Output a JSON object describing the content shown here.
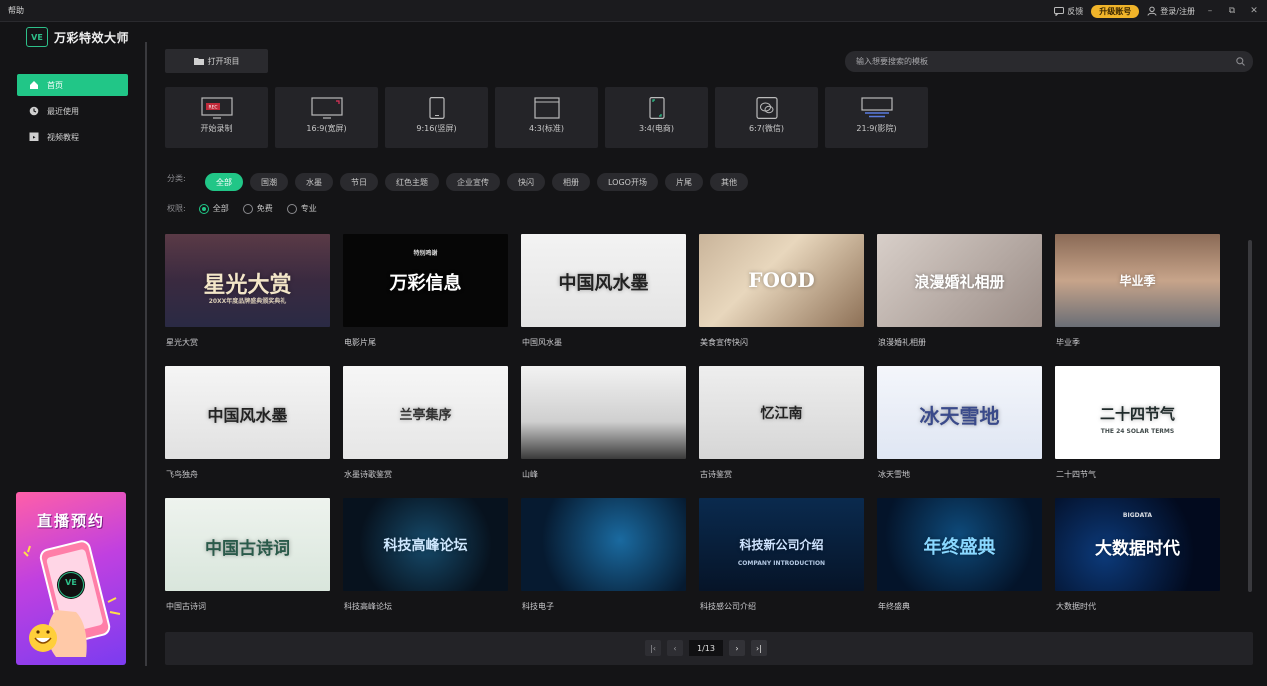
{
  "titlebar": {
    "menu_help": "帮助",
    "feedback": "反馈",
    "upgrade": "升级账号",
    "login": "登录/注册"
  },
  "sidebar": {
    "logo_mark": "VE",
    "app_name": "万彩特效大师",
    "items": [
      {
        "label": "首页",
        "icon": "home-icon"
      },
      {
        "label": "最近使用",
        "icon": "clock-icon"
      },
      {
        "label": "视频教程",
        "icon": "video-tutorial-icon"
      }
    ],
    "promo_title": "直播预约",
    "promo_mark": "VE"
  },
  "toolbar": {
    "open_project": "打开项目",
    "search_placeholder": "输入想要搜索的模板"
  },
  "presets": [
    {
      "label": "开始录制",
      "icon": "record-screen-icon"
    },
    {
      "label": "16:9(宽屏)",
      "icon": "widescreen-icon"
    },
    {
      "label": "9:16(竖屏)",
      "icon": "portrait-icon"
    },
    {
      "label": "4:3(标准)",
      "icon": "standard-icon"
    },
    {
      "label": "3:4(电商)",
      "icon": "ecommerce-icon"
    },
    {
      "label": "6:7(微信)",
      "icon": "wechat-icon"
    },
    {
      "label": "21:9(影院)",
      "icon": "cinema-icon"
    }
  ],
  "filters": {
    "category_label": "分类:",
    "categories": [
      "全部",
      "国潮",
      "水墨",
      "节日",
      "红色主题",
      "企业宣传",
      "快闪",
      "相册",
      "LOGO开场",
      "片尾",
      "其他"
    ],
    "permission_label": "权限:",
    "permissions": [
      "全部",
      "免费",
      "专业"
    ]
  },
  "templates": [
    {
      "name": "星光大赏",
      "text": "星光大赏",
      "bg": "linear-gradient(180deg,#5a3a46 0%,#3a2a40 50%,#2a2a44 100%)",
      "color": "#f3e6c8",
      "size": 22,
      "sub": "20XX年度品牌盛典颁奖典礼"
    },
    {
      "name": "电影片尾",
      "text": "万彩信息",
      "bg": "#060606",
      "color": "#ffffff",
      "size": 18,
      "sub": "特别鸣谢"
    },
    {
      "name": "中国风水墨",
      "text": "中国风水墨",
      "bg": "linear-gradient(180deg,#f3f3f3,#e4e4e4)",
      "color": "#222",
      "size": 18,
      "sub": ""
    },
    {
      "name": "美食宣传快闪",
      "text": "FOOD",
      "bg": "linear-gradient(135deg,#c9b49a 0%,#e8d7bd 40%,#8d7056 100%)",
      "color": "#ffffff",
      "size": 20,
      "sub": ""
    },
    {
      "name": "浪漫婚礼相册",
      "text": "浪漫婚礼相册",
      "bg": "linear-gradient(135deg,#d8cfc9,#9a8c86)",
      "color": "#ffffff",
      "size": 15,
      "sub": ""
    },
    {
      "name": "毕业季",
      "text": "毕业季",
      "bg": "linear-gradient(180deg,#8a6a56 0%,#c7a48a 50%,#6a6e76 100%)",
      "color": "#ffffff",
      "size": 12,
      "sub": ""
    },
    {
      "name": "飞鸟独舟",
      "text": "中国风水墨",
      "bg": "linear-gradient(180deg,#f5f5f5,#e1e1e1)",
      "color": "#222",
      "size": 16,
      "sub": ""
    },
    {
      "name": "水墨诗歌鉴赏",
      "text": "兰亭集序",
      "bg": "linear-gradient(180deg,#f6f6f6,#e6e6e6)",
      "color": "#333",
      "size": 13,
      "sub": ""
    },
    {
      "name": "山峰",
      "text": "",
      "bg": "linear-gradient(180deg,#f2f2f2 0%,#cfcfcf 60%,#3a3a3a 100%)",
      "color": "#222",
      "size": 14,
      "sub": ""
    },
    {
      "name": "古诗鉴赏",
      "text": "忆江南",
      "bg": "linear-gradient(180deg,#eeeeee,#d6d6d6)",
      "color": "#222",
      "size": 14,
      "sub": ""
    },
    {
      "name": "冰天雪地",
      "text": "冰天雪地",
      "bg": "linear-gradient(180deg,#f4f6fb,#dfe6f3)",
      "color": "#3a4a8a",
      "size": 20,
      "sub": ""
    },
    {
      "name": "二十四节气",
      "text": "二十四节气",
      "bg": "#ffffff",
      "color": "#1f2a2a",
      "size": 15,
      "sub": "THE 24 SOLAR TERMS"
    },
    {
      "name": "中国古诗词",
      "text": "中国古诗词",
      "bg": "linear-gradient(180deg,#eef3ee,#d9e6dc)",
      "color": "#2a5a4a",
      "size": 17,
      "sub": ""
    },
    {
      "name": "科技高峰论坛",
      "text": "科技高峰论坛",
      "bg": "radial-gradient(circle at 50% 50%,#164a6a 0%,#07121e 70%)",
      "color": "#cfe8ff",
      "size": 14,
      "sub": ""
    },
    {
      "name": "科技电子",
      "text": "",
      "bg": "radial-gradient(circle at 60% 45%,#1a6aa0 0%,#061a30 70%)",
      "color": "#9ad8ff",
      "size": 12,
      "sub": ""
    },
    {
      "name": "科技感公司介绍",
      "text": "科技新公司介绍",
      "bg": "linear-gradient(180deg,#0a2a4e,#061428)",
      "color": "#cfe4ff",
      "size": 12,
      "sub": "COMPANY INTRODUCTION"
    },
    {
      "name": "年终盛典",
      "text": "年终盛典",
      "bg": "radial-gradient(circle at 50% 40%,#0e4a7a 0%,#04142a 75%)",
      "color": "#8ad8ff",
      "size": 18,
      "sub": ""
    },
    {
      "name": "大数据时代",
      "text": "大数据时代",
      "bg": "radial-gradient(circle at 30% 60%,#0c3a7a 0%,#020a1e 70%)",
      "color": "#ffffff",
      "size": 17,
      "sub": "BIGDATA"
    }
  ],
  "pager": {
    "current": "1/13"
  },
  "colors": {
    "accent": "#21c687",
    "upgrade": "#f0b42a"
  }
}
